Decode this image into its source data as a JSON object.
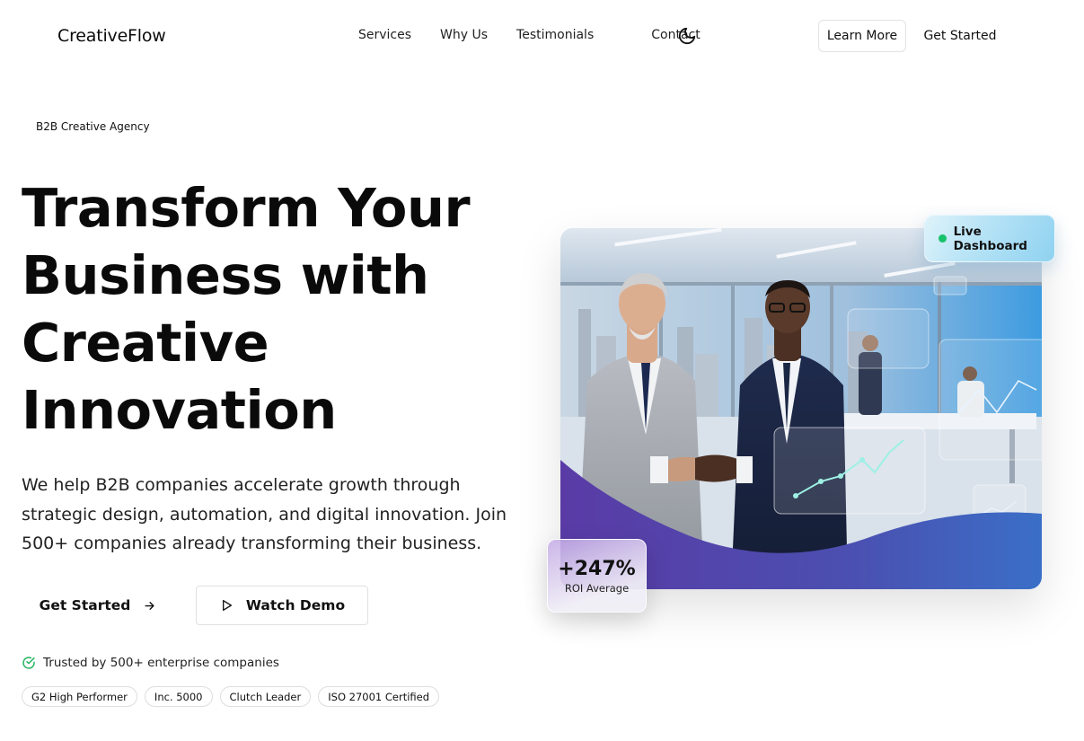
{
  "brand": {
    "name": "CreativeFlow"
  },
  "nav": {
    "links": [
      "Services",
      "Why Us",
      "Testimonials",
      "Contact"
    ],
    "learn_more": "Learn More",
    "get_started": "Get Started"
  },
  "hero": {
    "badge": "B2B Creative Agency",
    "headline": [
      "Transform Your",
      "Business with",
      "Creative",
      "Innovation"
    ],
    "subtext": "We help B2B companies accelerate growth through strategic design, automation, and digital innovation. Join 500+ companies already transforming their business.",
    "primary_cta": "Get Started",
    "secondary_cta": "Watch Demo",
    "trusted": "Trusted by 500+ enterprise companies",
    "certifications": [
      "G2 High Performer",
      "Inc. 5000",
      "Clutch Leader",
      "ISO 27001 Certified"
    ]
  },
  "visual": {
    "live_badge": "Live Dashboard",
    "roi_value": "+247%",
    "roi_label": "ROI Average"
  },
  "colors": {
    "accent_green": "#19c26a",
    "trusted_check": "#22b35e",
    "purple_wave": "#5b3fa8"
  },
  "icons": [
    "moon-icon",
    "arrow-right-icon",
    "play-icon",
    "check-circle-icon"
  ]
}
